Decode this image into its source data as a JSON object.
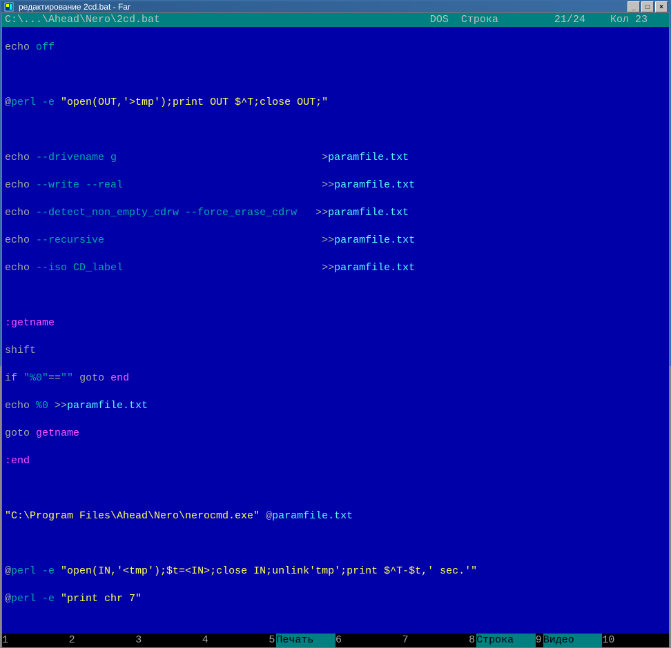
{
  "window": {
    "title": "редактирование 2cd.bat - Far"
  },
  "status": {
    "path": "C:\\...\\Ahead\\Nero\\2cd.bat",
    "encoding": "DOS",
    "line_label": "Строка",
    "line_value": "21/24",
    "col_label": "Кол",
    "col_value": "23"
  },
  "code": {
    "l1_a": "echo",
    "l1_b": " off",
    "l2_a": "@",
    "l2_b": "perl -e ",
    "l2_c": "\"open(OUT,'>tmp');print OUT $^T;close OUT;\"",
    "l3_a": "echo",
    "l3_b": " --drivename g                                 ",
    "l3_c": ">",
    "l3_d": "paramfile.txt",
    "l4_a": "echo",
    "l4_b": " --write --real                                ",
    "l4_c": ">>",
    "l4_d": "paramfile.txt",
    "l5_a": "echo",
    "l5_b": " --detect_non_empty_cdrw --force_erase_cdrw   ",
    "l5_c": ">>",
    "l5_d": "paramfile.txt",
    "l6_a": "echo",
    "l6_b": " --recursive                                   ",
    "l6_c": ">>",
    "l6_d": "paramfile.txt",
    "l7_a": "echo",
    "l7_b": " --iso CD_label                                ",
    "l7_c": ">>",
    "l7_d": "paramfile.txt",
    "l8": ":getname",
    "l9_a": "shift",
    "l10_a": "if",
    "l10_b": " \"%0\"",
    "l10_c": "==",
    "l10_d": "\"\" ",
    "l10_e": "goto",
    "l10_f": " ",
    "l10_g": "end",
    "l11_a": "echo",
    "l11_b": " %0 ",
    "l11_c": ">>",
    "l11_d": "paramfile.txt",
    "l12_a": "goto",
    "l12_b": " ",
    "l12_c": "getname",
    "l13": ":end",
    "l14_a": "\"C:\\Program Files\\Ahead\\Nero\\nerocmd.exe\"",
    "l14_b": " @",
    "l14_c": "paramfile.txt",
    "l15_a": "@",
    "l15_b": "perl -e ",
    "l15_c": "\"open(IN,'<tmp');$t=<IN>;close IN;unlink'tmp';print $^T-$t,' sec.'\"",
    "l16_a": "@",
    "l16_b": "perl -e ",
    "l16_c": "\"print chr 7\""
  },
  "keybar": {
    "k1": "",
    "k2": "",
    "k3": "",
    "k4": "",
    "k5": "Печать",
    "k6": "",
    "k7": "",
    "k8": "Строка",
    "k9": "Видео",
    "k10": ""
  },
  "nums": {
    "n1": "1",
    "n2": "2",
    "n3": "3",
    "n4": "4",
    "n5": "5",
    "n6": "6",
    "n7": "7",
    "n8": "8",
    "n9": "9",
    "n10": "10"
  }
}
